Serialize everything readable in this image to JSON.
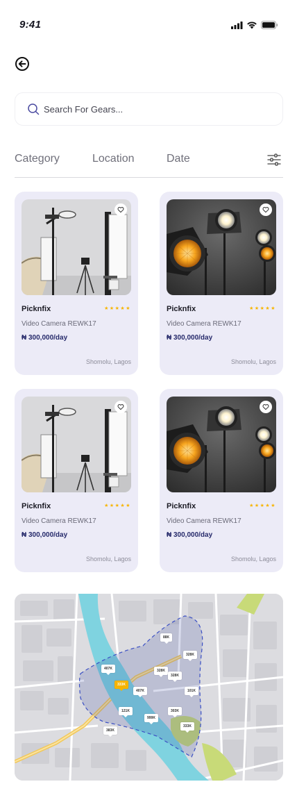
{
  "status_bar": {
    "time": "9:41"
  },
  "search": {
    "placeholder": "Search For Gears..."
  },
  "filters": {
    "tabs": [
      "Category",
      "Location",
      "Date"
    ]
  },
  "listings": [
    {
      "brand": "Picknfix",
      "model": "Video Camera REWK17",
      "price": "₦ 300,000/day",
      "location": "Shomolu, Lagos",
      "rating": "★★★★★",
      "image": "studio-lights-photo"
    },
    {
      "brand": "Picknfix",
      "model": "Video Camera REWK17",
      "price": "₦ 300,000/day",
      "location": "Shomolu, Lagos",
      "rating": "★★★★★",
      "image": "spotlights-photo"
    },
    {
      "brand": "Picknfix",
      "model": "Video Camera REWK17",
      "price": "₦ 300,000/day",
      "location": "Shomolu, Lagos",
      "rating": "★★★★★",
      "image": "studio-lights-photo"
    },
    {
      "brand": "Picknfix",
      "model": "Video Camera REWK17",
      "price": "₦ 300,000/day",
      "location": "Shomolu, Lagos",
      "rating": "★★★★★",
      "image": "spotlights-photo"
    }
  ],
  "map": {
    "pins": [
      "88K",
      "328K",
      "407K",
      "328K",
      "328K",
      "333K",
      "407K",
      "101K",
      "121K",
      "999K",
      "303K",
      "333K",
      "383K"
    ],
    "active_pin": "333K"
  },
  "colors": {
    "accent": "#262a6b",
    "card_bg": "#ecebf7",
    "star": "#f7b500",
    "river": "#7fd3e0",
    "active_pin": "#f5b400"
  }
}
